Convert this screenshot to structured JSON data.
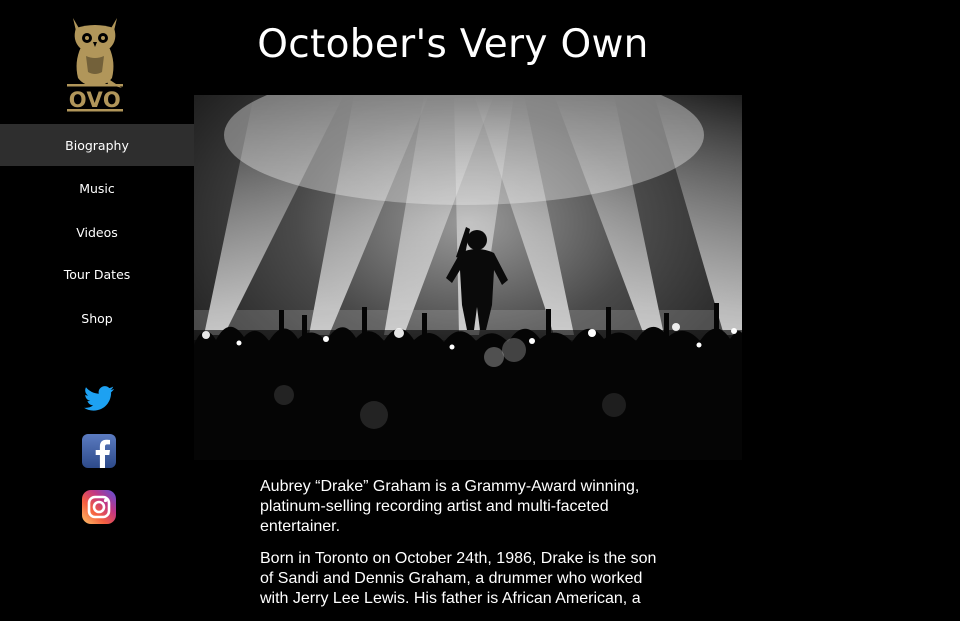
{
  "brand": {
    "logo_text": "OVO",
    "logo_color": "#b1965a"
  },
  "header": {
    "title": "October's Very Own"
  },
  "nav": {
    "items": [
      {
        "label": "Biography",
        "active": true
      },
      {
        "label": "Music",
        "active": false
      },
      {
        "label": "Videos",
        "active": false
      },
      {
        "label": "Tour Dates",
        "active": false
      },
      {
        "label": "Shop",
        "active": false
      }
    ]
  },
  "social": [
    {
      "icon": "twitter-icon",
      "color": "#1da1f2"
    },
    {
      "icon": "facebook-icon",
      "color": "#3b5998"
    },
    {
      "icon": "instagram-icon",
      "color": "#c13584"
    }
  ],
  "hero": {
    "icon": "concert-photo"
  },
  "bio": {
    "paragraphs": [
      "Aubrey “Drake” Graham is a Grammy-Award winning, platinum-selling recording artist and multi-faceted entertainer.",
      "Born in Toronto on October 24th, 1986, Drake is the son of Sandi and Dennis Graham, a drummer who worked with Jerry Lee Lewis. His father is African American, a"
    ]
  }
}
